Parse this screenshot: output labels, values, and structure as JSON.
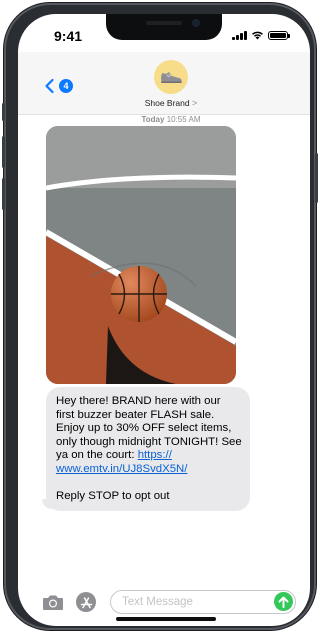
{
  "status_bar": {
    "time": "9:41"
  },
  "header": {
    "back_badge": "4",
    "contact_name": "Shoe Brand",
    "contact_chevron": ">",
    "avatar_icon": "sneaker-icon",
    "avatar_color": "#f7dd8a"
  },
  "conversation": {
    "timestamp_day": "Today",
    "timestamp_time": "10:55 AM",
    "image": {
      "icon": "basketball-court-photo"
    },
    "message": {
      "lines": [
        "Hey there! BRAND here with our",
        "first buzzer beater FLASH sale.",
        "Enjoy up to 30% OFF select items,",
        "only though midnight TONIGHT! See",
        "ya on the court: "
      ],
      "link_part1": "https://",
      "link_part2": "www.emtv.in/UJ8SvdX5N/",
      "opt_out": "Reply STOP to opt out"
    }
  },
  "composer": {
    "placeholder": "Text Message",
    "camera_icon": "camera-icon",
    "apps_icon": "app-store-icon",
    "send_icon": "arrow-up-icon",
    "send_color": "#34c759"
  },
  "colors": {
    "accent": "#0a7aff",
    "bubble": "#e9e9eb",
    "link": "#0a62d6"
  }
}
